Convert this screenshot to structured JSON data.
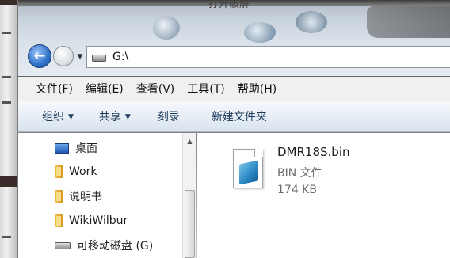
{
  "window": {
    "title": "打开破解"
  },
  "address_bar": {
    "path": "G:\\"
  },
  "menu": [
    "文件(F)",
    "编辑(E)",
    "查看(V)",
    "工具(T)",
    "帮助(H)"
  ],
  "commands": {
    "organize": "组织",
    "share": "共享",
    "burn": "刻录",
    "new_folder": "新建文件夹"
  },
  "nav_pane": {
    "items": [
      {
        "label": "桌面",
        "icon": "desktop-icon"
      },
      {
        "label": "Work",
        "icon": "folder-icon"
      },
      {
        "label": "说明书",
        "icon": "folder-icon"
      },
      {
        "label": "WikiWilbur",
        "icon": "folder-icon"
      },
      {
        "label": "可移动磁盘 (G)",
        "icon": "removable-drive-icon"
      }
    ]
  },
  "file": {
    "name": "DMR18S.bin",
    "type": "BIN 文件",
    "size": "174 KB",
    "icon": "bin-file-icon"
  },
  "colors": {
    "accent": "#2f6fc6",
    "command_text": "#1e3b5c",
    "secondary_text": "#6d6d6d"
  }
}
